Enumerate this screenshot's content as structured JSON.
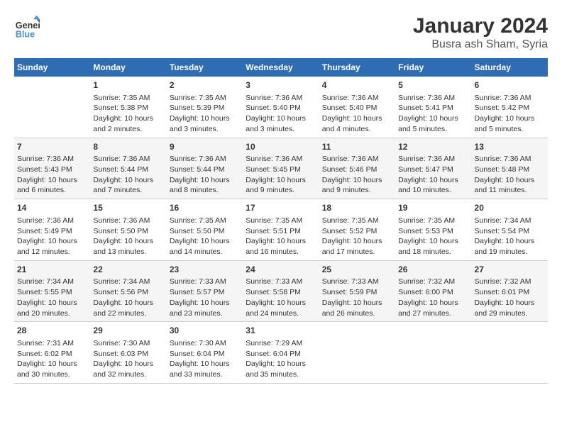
{
  "header": {
    "logo_line1": "General",
    "logo_line2": "Blue",
    "title": "January 2024",
    "subtitle": "Busra ash Sham, Syria"
  },
  "columns": [
    "Sunday",
    "Monday",
    "Tuesday",
    "Wednesday",
    "Thursday",
    "Friday",
    "Saturday"
  ],
  "weeks": [
    [
      {
        "day": "",
        "info": ""
      },
      {
        "day": "1",
        "info": "Sunrise: 7:35 AM\nSunset: 5:38 PM\nDaylight: 10 hours\nand 2 minutes."
      },
      {
        "day": "2",
        "info": "Sunrise: 7:35 AM\nSunset: 5:39 PM\nDaylight: 10 hours\nand 3 minutes."
      },
      {
        "day": "3",
        "info": "Sunrise: 7:36 AM\nSunset: 5:40 PM\nDaylight: 10 hours\nand 3 minutes."
      },
      {
        "day": "4",
        "info": "Sunrise: 7:36 AM\nSunset: 5:40 PM\nDaylight: 10 hours\nand 4 minutes."
      },
      {
        "day": "5",
        "info": "Sunrise: 7:36 AM\nSunset: 5:41 PM\nDaylight: 10 hours\nand 5 minutes."
      },
      {
        "day": "6",
        "info": "Sunrise: 7:36 AM\nSunset: 5:42 PM\nDaylight: 10 hours\nand 5 minutes."
      }
    ],
    [
      {
        "day": "7",
        "info": "Sunrise: 7:36 AM\nSunset: 5:43 PM\nDaylight: 10 hours\nand 6 minutes."
      },
      {
        "day": "8",
        "info": "Sunrise: 7:36 AM\nSunset: 5:44 PM\nDaylight: 10 hours\nand 7 minutes."
      },
      {
        "day": "9",
        "info": "Sunrise: 7:36 AM\nSunset: 5:44 PM\nDaylight: 10 hours\nand 8 minutes."
      },
      {
        "day": "10",
        "info": "Sunrise: 7:36 AM\nSunset: 5:45 PM\nDaylight: 10 hours\nand 9 minutes."
      },
      {
        "day": "11",
        "info": "Sunrise: 7:36 AM\nSunset: 5:46 PM\nDaylight: 10 hours\nand 9 minutes."
      },
      {
        "day": "12",
        "info": "Sunrise: 7:36 AM\nSunset: 5:47 PM\nDaylight: 10 hours\nand 10 minutes."
      },
      {
        "day": "13",
        "info": "Sunrise: 7:36 AM\nSunset: 5:48 PM\nDaylight: 10 hours\nand 11 minutes."
      }
    ],
    [
      {
        "day": "14",
        "info": "Sunrise: 7:36 AM\nSunset: 5:49 PM\nDaylight: 10 hours\nand 12 minutes."
      },
      {
        "day": "15",
        "info": "Sunrise: 7:36 AM\nSunset: 5:50 PM\nDaylight: 10 hours\nand 13 minutes."
      },
      {
        "day": "16",
        "info": "Sunrise: 7:35 AM\nSunset: 5:50 PM\nDaylight: 10 hours\nand 14 minutes."
      },
      {
        "day": "17",
        "info": "Sunrise: 7:35 AM\nSunset: 5:51 PM\nDaylight: 10 hours\nand 16 minutes."
      },
      {
        "day": "18",
        "info": "Sunrise: 7:35 AM\nSunset: 5:52 PM\nDaylight: 10 hours\nand 17 minutes."
      },
      {
        "day": "19",
        "info": "Sunrise: 7:35 AM\nSunset: 5:53 PM\nDaylight: 10 hours\nand 18 minutes."
      },
      {
        "day": "20",
        "info": "Sunrise: 7:34 AM\nSunset: 5:54 PM\nDaylight: 10 hours\nand 19 minutes."
      }
    ],
    [
      {
        "day": "21",
        "info": "Sunrise: 7:34 AM\nSunset: 5:55 PM\nDaylight: 10 hours\nand 20 minutes."
      },
      {
        "day": "22",
        "info": "Sunrise: 7:34 AM\nSunset: 5:56 PM\nDaylight: 10 hours\nand 22 minutes."
      },
      {
        "day": "23",
        "info": "Sunrise: 7:33 AM\nSunset: 5:57 PM\nDaylight: 10 hours\nand 23 minutes."
      },
      {
        "day": "24",
        "info": "Sunrise: 7:33 AM\nSunset: 5:58 PM\nDaylight: 10 hours\nand 24 minutes."
      },
      {
        "day": "25",
        "info": "Sunrise: 7:33 AM\nSunset: 5:59 PM\nDaylight: 10 hours\nand 26 minutes."
      },
      {
        "day": "26",
        "info": "Sunrise: 7:32 AM\nSunset: 6:00 PM\nDaylight: 10 hours\nand 27 minutes."
      },
      {
        "day": "27",
        "info": "Sunrise: 7:32 AM\nSunset: 6:01 PM\nDaylight: 10 hours\nand 29 minutes."
      }
    ],
    [
      {
        "day": "28",
        "info": "Sunrise: 7:31 AM\nSunset: 6:02 PM\nDaylight: 10 hours\nand 30 minutes."
      },
      {
        "day": "29",
        "info": "Sunrise: 7:30 AM\nSunset: 6:03 PM\nDaylight: 10 hours\nand 32 minutes."
      },
      {
        "day": "30",
        "info": "Sunrise: 7:30 AM\nSunset: 6:04 PM\nDaylight: 10 hours\nand 33 minutes."
      },
      {
        "day": "31",
        "info": "Sunrise: 7:29 AM\nSunset: 6:04 PM\nDaylight: 10 hours\nand 35 minutes."
      },
      {
        "day": "",
        "info": ""
      },
      {
        "day": "",
        "info": ""
      },
      {
        "day": "",
        "info": ""
      }
    ]
  ]
}
